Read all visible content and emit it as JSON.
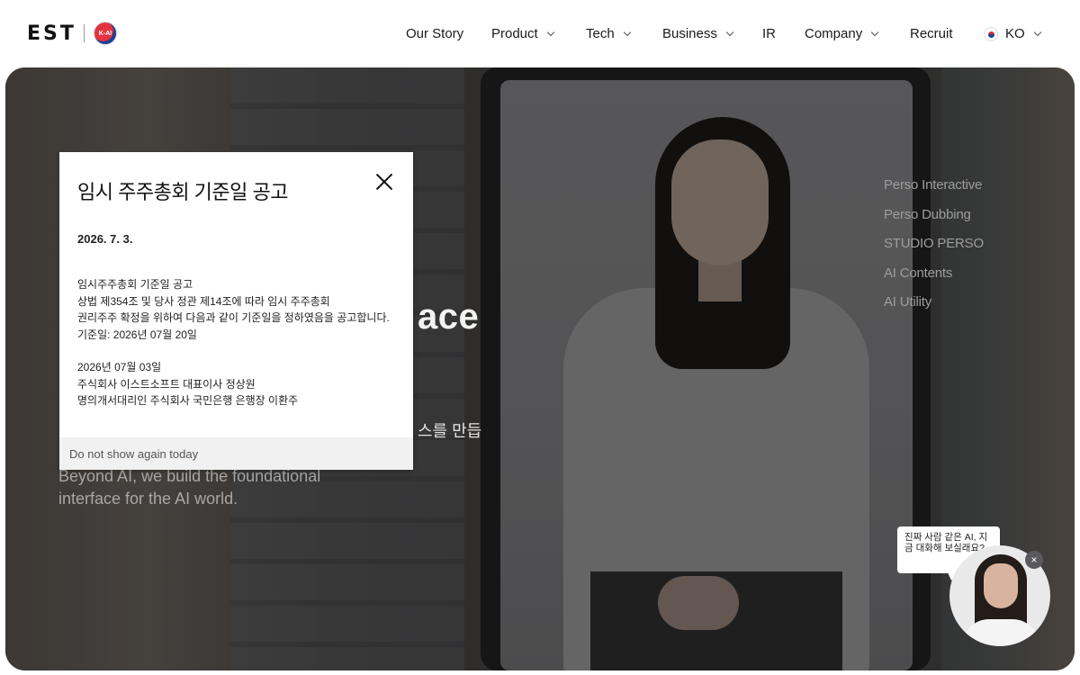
{
  "brand": {
    "logo_text": "EST",
    "badge_text": "K-AI"
  },
  "nav": {
    "items": [
      {
        "label": "Our Story",
        "dropdown": false
      },
      {
        "label": "Product",
        "dropdown": true
      },
      {
        "label": "Tech",
        "dropdown": true
      },
      {
        "label": "Business",
        "dropdown": true
      },
      {
        "label": "IR",
        "dropdown": false
      },
      {
        "label": "Company",
        "dropdown": true
      },
      {
        "label": "Recruit",
        "dropdown": false
      }
    ],
    "language": "KO",
    "language_icon": "korea-flag-icon"
  },
  "hero": {
    "title_fragment": "ace",
    "kr_fragment": "스를 만듭",
    "subtitle_lines": [
      "Beyond AI, we build the foundational",
      "interface for the AI world."
    ],
    "side_menu": [
      "Perso Interactive",
      "Perso Dubbing",
      "STUDIO PERSO",
      "AI Contents",
      "AI Utility"
    ]
  },
  "popup": {
    "title": "임시 주주총회 기준일 공고",
    "date": "2026. 7. 3.",
    "body_block1": [
      "임시주주총회 기준일 공고",
      "상법 제354조 및 당사 정관 제14조에 따라 임시 주주총회",
      "권리주주 확정을 위하여 다음과 같이 기준일을 정하였음을 공고합니다.",
      "기준일: 2026년 07월 20일"
    ],
    "body_block2": [
      "2026년 07월 03일",
      "주식회사 이스트소프트 대표이사 정상원",
      "명의개서대리인 주식회사 국민은행 은행장 이환주"
    ],
    "footer": "Do not show again today"
  },
  "chat_widget": {
    "bubble_text": "진짜 사람 같은 AI, 지금 대화해 보실래요?",
    "close_symbol": "×"
  }
}
